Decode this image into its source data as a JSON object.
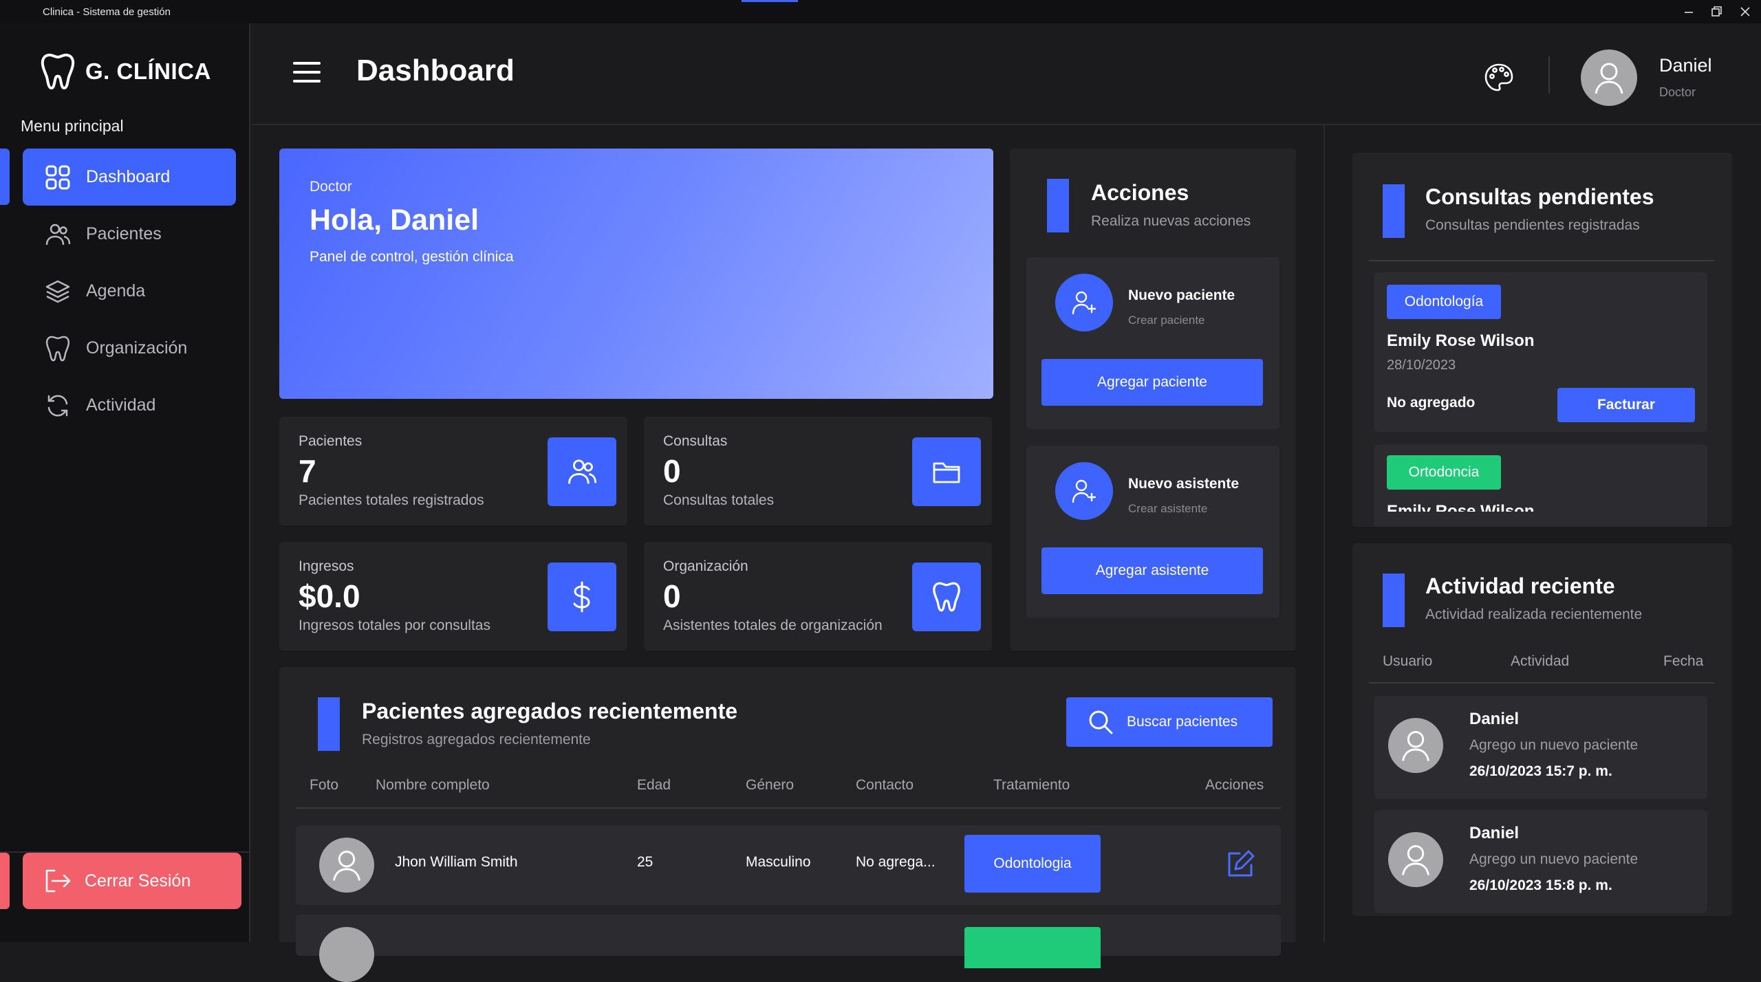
{
  "window": {
    "title": "Clinica - Sistema de gestión"
  },
  "sidebar": {
    "brand": "G. CLÍNICA",
    "menu_title": "Menu principal",
    "items": [
      {
        "label": "Dashboard",
        "icon": "grid-icon",
        "active": true
      },
      {
        "label": "Pacientes",
        "icon": "users-icon",
        "active": false
      },
      {
        "label": "Agenda",
        "icon": "layers-icon",
        "active": false
      },
      {
        "label": "Organización",
        "icon": "tooth-icon",
        "active": false
      },
      {
        "label": "Actividad",
        "icon": "refresh-icon",
        "active": false
      }
    ],
    "logout_label": "Cerrar Sesión"
  },
  "header": {
    "title": "Dashboard",
    "user_name": "Daniel",
    "user_role": "Doctor"
  },
  "hero": {
    "role": "Doctor",
    "greeting": "Hola, Daniel",
    "description": "Panel de control, gestión clínica"
  },
  "stats": [
    {
      "label": "Pacientes",
      "value": "7",
      "sub": "Pacientes totales registrados",
      "icon": "users-icon"
    },
    {
      "label": "Consultas",
      "value": "0",
      "sub": "Consultas totales",
      "icon": "folder-icon"
    },
    {
      "label": "Ingresos",
      "value": "$0.0",
      "sub": "Ingresos totales por consultas",
      "icon": "dollar-icon"
    },
    {
      "label": "Organización",
      "value": "0",
      "sub": "Asistentes totales de organización",
      "icon": "tooth-icon"
    }
  ],
  "actions": {
    "title": "Acciones",
    "subtitle": "Realiza nuevas acciones",
    "cards": [
      {
        "title": "Nuevo paciente",
        "subtitle": "Crear paciente",
        "button": "Agregar paciente"
      },
      {
        "title": "Nuevo asistente",
        "subtitle": "Crear asistente",
        "button": "Agregar asistente"
      }
    ]
  },
  "recent_patients": {
    "title": "Pacientes agregados recientemente",
    "subtitle": "Registros agregados recientemente",
    "search_button": "Buscar pacientes",
    "columns": [
      "Foto",
      "Nombre completo",
      "Edad",
      "Género",
      "Contacto",
      "Tratamiento",
      "Acciones"
    ],
    "rows": [
      {
        "name": "Jhon William Smith",
        "age": "25",
        "gender": "Masculino",
        "contact": "No agrega...",
        "treatment": "Odontologia"
      }
    ]
  },
  "pending": {
    "title": "Consultas pendientes",
    "subtitle": "Consultas pendientes registradas",
    "items": [
      {
        "tag": "Odontología",
        "tag_color": "#3e63ff",
        "patient": "Emily Rose Wilson",
        "date": "28/10/2023",
        "status": "No agregado",
        "button": "Facturar"
      },
      {
        "tag": "Ortodoncia",
        "tag_color": "#1fca78",
        "patient": "Emily Rose Wilson"
      }
    ]
  },
  "activity": {
    "title": "Actividad reciente",
    "subtitle": "Actividad realizada recientemente",
    "columns": [
      "Usuario",
      "Actividad",
      "Fecha"
    ],
    "items": [
      {
        "user": "Daniel",
        "action": "Agrego un nuevo paciente",
        "date": "26/10/2023 15:7 p. m."
      },
      {
        "user": "Daniel",
        "action": "Agrego un nuevo paciente",
        "date": "26/10/2023 15:8 p. m."
      }
    ]
  },
  "colors": {
    "accent": "#3e63ff",
    "danger": "#f2616b",
    "success": "#1fca78",
    "background": "#1b1b1d",
    "card": "#242427"
  }
}
